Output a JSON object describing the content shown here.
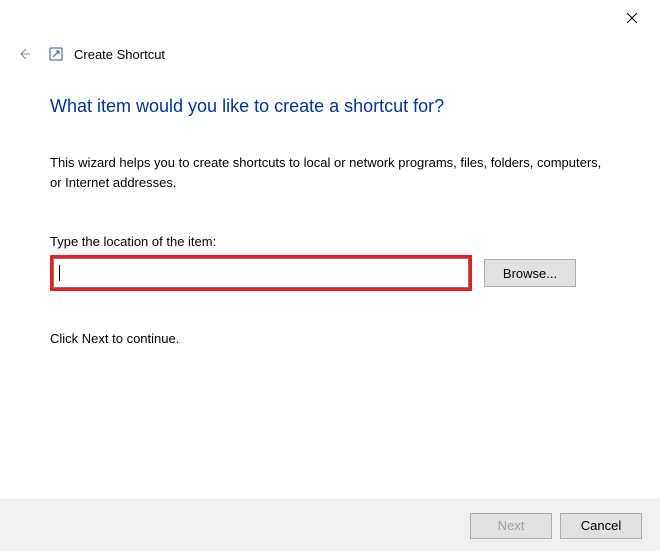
{
  "window": {
    "title": "Create Shortcut"
  },
  "main": {
    "heading": "What item would you like to create a shortcut for?",
    "description": "This wizard helps you to create shortcuts to local or network programs, files, folders, computers, or Internet addresses.",
    "input_label": "Type the location of the item:",
    "input_value": "",
    "browse_label": "Browse...",
    "continue_text": "Click Next to continue."
  },
  "footer": {
    "next_label": "Next",
    "cancel_label": "Cancel"
  }
}
